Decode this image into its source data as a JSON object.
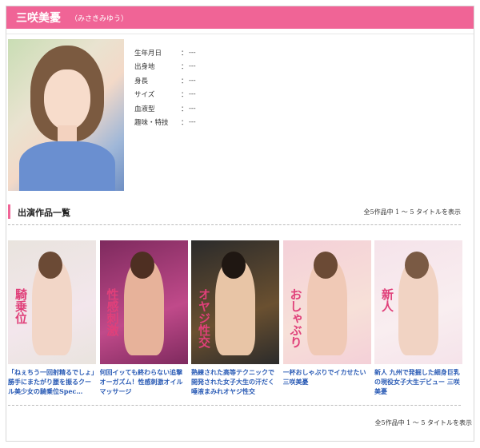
{
  "actress": {
    "name": "三咲美憂",
    "kana": "（みさきみゆう）"
  },
  "profile": [
    {
      "label": "生年月日",
      "value": "---"
    },
    {
      "label": "出身地",
      "value": "---"
    },
    {
      "label": "身長",
      "value": "---"
    },
    {
      "label": "サイズ",
      "value": "---"
    },
    {
      "label": "血液型",
      "value": "---"
    },
    {
      "label": "趣味・特技",
      "value": "---"
    }
  ],
  "works_section": {
    "title": "出演作品一覧",
    "count_text": "全5作品中 1 〜 5 タイトルを表示"
  },
  "works": [
    {
      "title": "「ねぇちう一回射精るでしょ」勝手にまたがり腰を振るクール美少女の騎乗位Spec…",
      "cover_text": "騎乗位",
      "colors": [
        "#e9e4de",
        "#f3e6ec",
        "#f2d6c7",
        "#6b4a35"
      ]
    },
    {
      "title": "何回イッても終わらない追撃オーガズム！性感刺激オイルマッサージ",
      "cover_text": "性感刺激",
      "colors": [
        "#7e2a5e",
        "#c04a8a",
        "#e7b29a",
        "#4e2f22"
      ]
    },
    {
      "title": "熟練された高等テクニックで開発された女子大生の汗だく唾液まみれオヤジ性交",
      "cover_text": "オヤジ性交",
      "colors": [
        "#2b2b2b",
        "#6a5030",
        "#e8c5a6",
        "#1f1712"
      ]
    },
    {
      "title": "一杯おしゃぶりでイカせたい三咲美憂",
      "cover_text": "おしゃぶり",
      "colors": [
        "#f4d0d8",
        "#f7e0d8",
        "#f0c9b6",
        "#6b4a35"
      ]
    },
    {
      "title": "新人 九州で発掘した細身巨乳の現役女子大生デビュー 三咲美憂",
      "cover_text": "新人",
      "colors": [
        "#f5e3ea",
        "#f9eef0",
        "#f1d3c3",
        "#7a5a44"
      ]
    }
  ],
  "footer": {
    "count_text": "全5作品中 1 〜 5 タイトルを表示"
  }
}
